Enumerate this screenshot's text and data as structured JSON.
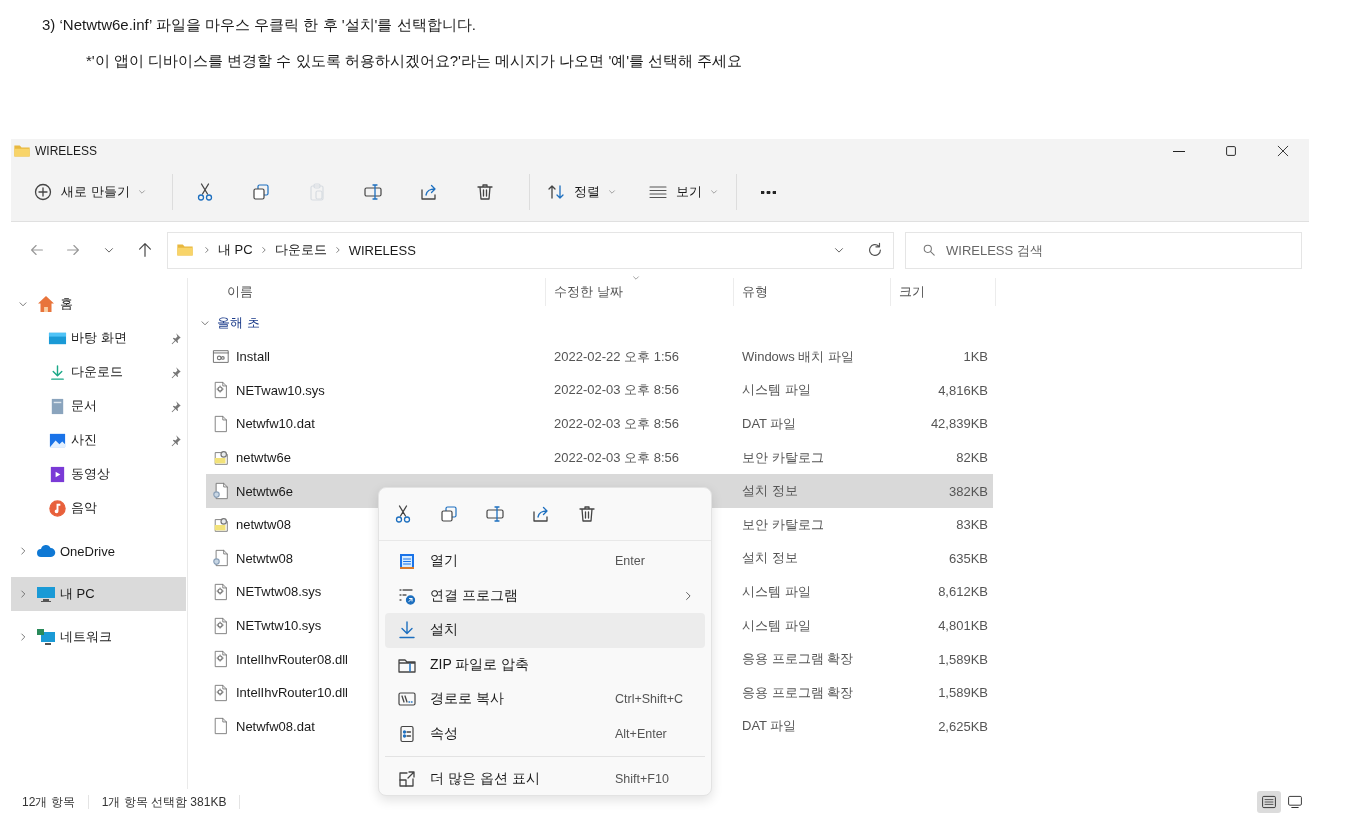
{
  "instructions": {
    "step": "3) ‘Netwtw6e.inf’ 파일을  마우스 우클릭 한 후 '설치'를 선택합니다.",
    "note": "*'이 앱이 디바이스를 변경할 수 있도록 허용하시겠어요?'라는 메시지가 나오면 '예'를 선택해 주세요"
  },
  "window": {
    "title": "WIRELESS"
  },
  "toolbar": {
    "new_button": "새로 만들기",
    "actions": [
      {
        "kind": "cut",
        "disabled": false
      },
      {
        "kind": "copy",
        "disabled": false
      },
      {
        "kind": "paste",
        "disabled": true
      },
      {
        "kind": "rename",
        "disabled": false
      },
      {
        "kind": "share",
        "disabled": false
      },
      {
        "kind": "delete",
        "disabled": false
      }
    ],
    "sort_button": "정렬",
    "view_button": "보기"
  },
  "address_bar": {
    "path": [
      "내 PC",
      "다운로드",
      "WIRELESS"
    ]
  },
  "search": {
    "placeholder": "WIRELESS 검색"
  },
  "sidebar": {
    "items": [
      {
        "label": "홈",
        "kind": "home",
        "expanded": true,
        "selected": false,
        "children": [
          {
            "label": "바탕 화면",
            "kind": "desktop",
            "pinned": true,
            "selected": false
          },
          {
            "label": "다운로드",
            "kind": "download",
            "pinned": true,
            "selected": false
          },
          {
            "label": "문서",
            "kind": "documents",
            "pinned": true,
            "selected": false
          },
          {
            "label": "사진",
            "kind": "pictures",
            "pinned": true,
            "selected": false
          },
          {
            "label": "동영상",
            "kind": "videos",
            "pinned": false,
            "selected": false
          },
          {
            "label": "음악",
            "kind": "music",
            "pinned": false,
            "selected": false
          }
        ]
      },
      {
        "label": "OneDrive",
        "kind": "cloud",
        "expanded": false,
        "selected": false
      },
      {
        "label": "내 PC",
        "kind": "pc",
        "expanded": false,
        "selected": true
      },
      {
        "label": "네트워크",
        "kind": "network",
        "expanded": false,
        "selected": false
      }
    ]
  },
  "table": {
    "columns": [
      {
        "label": "이름",
        "sorted": false
      },
      {
        "label": "수정한 날짜",
        "sorted": true
      },
      {
        "label": "유형",
        "sorted": false
      },
      {
        "label": "크기",
        "sorted": false
      }
    ],
    "group": {
      "label": "올해 초",
      "expanded": true
    },
    "rows": [
      {
        "name": "Install",
        "kind": "batch",
        "date": "2022-02-22 오후 1:56",
        "type": "Windows 배치 파일",
        "size": "1KB",
        "selected": false
      },
      {
        "name": "NETwaw10.sys",
        "kind": "system",
        "date": "2022-02-03 오후 8:56",
        "type": "시스템 파일",
        "size": "4,816KB",
        "selected": false
      },
      {
        "name": "Netwfw10.dat",
        "kind": "blank",
        "date": "2022-02-03 오후 8:56",
        "type": "DAT 파일",
        "size": "42,839KB",
        "selected": false
      },
      {
        "name": "netwtw6e",
        "kind": "catalog",
        "date": "2022-02-03 오후 8:56",
        "type": "보안 카탈로그",
        "size": "82KB",
        "selected": false
      },
      {
        "name": "Netwtw6e",
        "kind": "setup",
        "type": "설치 정보",
        "size": "382KB",
        "selected": true
      },
      {
        "name": "netwtw08",
        "kind": "catalog",
        "type": "보안 카탈로그",
        "size": "83KB",
        "selected": false
      },
      {
        "name": "Netwtw08",
        "kind": "setup",
        "type": "설치 정보",
        "size": "635KB",
        "selected": false
      },
      {
        "name": "NETwtw08.sys",
        "kind": "system",
        "type": "시스템 파일",
        "size": "8,612KB",
        "selected": false
      },
      {
        "name": "NETwtw10.sys",
        "kind": "system",
        "type": "시스템 파일",
        "size": "4,801KB",
        "selected": false
      },
      {
        "name": "IntelIhvRouter08.dll",
        "kind": "system",
        "type": "응용 프로그램 확장",
        "size": "1,589KB",
        "selected": false
      },
      {
        "name": "IntelIhvRouter10.dll",
        "kind": "system",
        "type": "응용 프로그램 확장",
        "size": "1,589KB",
        "selected": false
      },
      {
        "name": "Netwfw08.dat",
        "kind": "blank",
        "type": "DAT 파일",
        "size": "2,625KB",
        "selected": false
      }
    ]
  },
  "context_menu": {
    "quick_actions": [
      {
        "kind": "cut"
      },
      {
        "kind": "copy"
      },
      {
        "kind": "rename"
      },
      {
        "kind": "share"
      },
      {
        "kind": "delete"
      }
    ],
    "groups": [
      {
        "items": [
          {
            "label": "열기",
            "kind": "open",
            "shortcut": "Enter",
            "submenu": false,
            "highlighted": false
          },
          {
            "label": "연결 프로그램",
            "kind": "open-with",
            "submenu": true,
            "highlighted": false
          },
          {
            "label": "설치",
            "kind": "install",
            "submenu": false,
            "highlighted": true
          },
          {
            "label": "ZIP 파일로 압축",
            "kind": "zip",
            "submenu": false,
            "highlighted": false
          },
          {
            "label": "경로로 복사",
            "kind": "copy-path",
            "shortcut": "Ctrl+Shift+C",
            "submenu": false,
            "highlighted": false
          },
          {
            "label": "속성",
            "kind": "properties",
            "shortcut": "Alt+Enter",
            "submenu": false,
            "highlighted": false
          }
        ]
      },
      {
        "items": [
          {
            "label": "더 많은 옵션 표시",
            "kind": "more-options",
            "shortcut": "Shift+F10",
            "submenu": false,
            "highlighted": false
          }
        ]
      }
    ]
  },
  "status_bar": {
    "item_count": "12개 항목",
    "selection": "1개 항목 선택함 381KB",
    "views": [
      {
        "kind": "details",
        "selected": true
      },
      {
        "kind": "tiles",
        "selected": false
      }
    ]
  }
}
